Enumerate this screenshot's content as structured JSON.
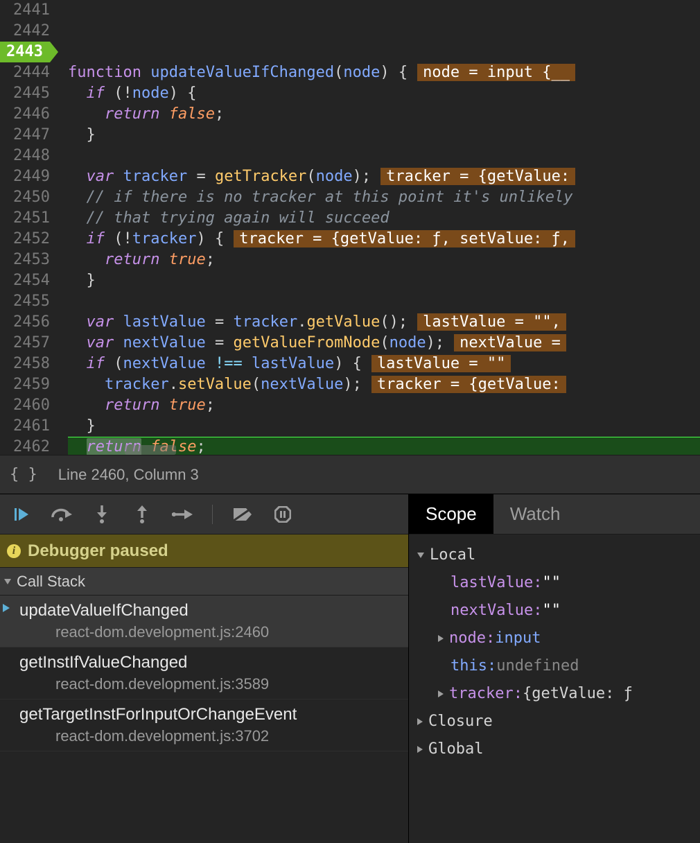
{
  "editor": {
    "first_line": 2441,
    "exec_line": 2443,
    "active_line": 2460,
    "lines": [
      {
        "n": 2441,
        "t": ""
      },
      {
        "n": 2442,
        "t": "function updateValueIfChanged(node) {",
        "eval": "node = input {__",
        "tokens": [
          [
            "kw-fn",
            "function"
          ],
          [
            "plain",
            " "
          ],
          [
            "fn-name",
            "updateValueIfChanged"
          ],
          [
            "paren",
            "("
          ],
          [
            "var-name",
            "node"
          ],
          [
            "paren",
            ")"
          ],
          [
            "plain",
            " {"
          ]
        ]
      },
      {
        "n": 2443,
        "tokens": [
          [
            "plain",
            "  "
          ],
          [
            "kw",
            "if"
          ],
          [
            "plain",
            " (!"
          ],
          [
            "var-name",
            "node"
          ],
          [
            "paren",
            ")"
          ],
          [
            "plain",
            " {"
          ]
        ]
      },
      {
        "n": 2444,
        "tokens": [
          [
            "plain",
            "    "
          ],
          [
            "kw",
            "return"
          ],
          [
            "plain",
            " "
          ],
          [
            "bool",
            "false"
          ],
          [
            "plain",
            ";"
          ]
        ]
      },
      {
        "n": 2445,
        "tokens": [
          [
            "plain",
            "  }"
          ]
        ]
      },
      {
        "n": 2446,
        "tokens": []
      },
      {
        "n": 2447,
        "eval": "tracker = {getValue:",
        "tokens": [
          [
            "plain",
            "  "
          ],
          [
            "kw",
            "var"
          ],
          [
            "plain",
            " "
          ],
          [
            "var-name",
            "tracker"
          ],
          [
            "plain",
            " = "
          ],
          [
            "call",
            "getTracker"
          ],
          [
            "paren",
            "("
          ],
          [
            "var-name",
            "node"
          ],
          [
            "paren",
            ")"
          ],
          [
            "plain",
            ";"
          ]
        ]
      },
      {
        "n": 2448,
        "tokens": [
          [
            "plain",
            "  "
          ],
          [
            "comment",
            "// if there is no tracker at this point it's unlikely"
          ]
        ]
      },
      {
        "n": 2449,
        "tokens": [
          [
            "plain",
            "  "
          ],
          [
            "comment",
            "// that trying again will succeed"
          ]
        ]
      },
      {
        "n": 2450,
        "eval": "tracker = {getValue: ƒ, setValue: ƒ,",
        "tokens": [
          [
            "plain",
            "  "
          ],
          [
            "kw",
            "if"
          ],
          [
            "plain",
            " (!"
          ],
          [
            "var-name",
            "tracker"
          ],
          [
            "paren",
            ")"
          ],
          [
            "plain",
            " {"
          ]
        ]
      },
      {
        "n": 2451,
        "tokens": [
          [
            "plain",
            "    "
          ],
          [
            "kw",
            "return"
          ],
          [
            "plain",
            " "
          ],
          [
            "bool",
            "true"
          ],
          [
            "plain",
            ";"
          ]
        ]
      },
      {
        "n": 2452,
        "tokens": [
          [
            "plain",
            "  }"
          ]
        ]
      },
      {
        "n": 2453,
        "tokens": []
      },
      {
        "n": 2454,
        "eval": "lastValue = \"\",",
        "tokens": [
          [
            "plain",
            "  "
          ],
          [
            "kw",
            "var"
          ],
          [
            "plain",
            " "
          ],
          [
            "var-name",
            "lastValue"
          ],
          [
            "plain",
            " = "
          ],
          [
            "var-name",
            "tracker"
          ],
          [
            "plain",
            "."
          ],
          [
            "call",
            "getValue"
          ],
          [
            "paren",
            "()"
          ],
          [
            "plain",
            ";"
          ]
        ]
      },
      {
        "n": 2455,
        "eval": "nextValue =",
        "tokens": [
          [
            "plain",
            "  "
          ],
          [
            "kw",
            "var"
          ],
          [
            "plain",
            " "
          ],
          [
            "var-name",
            "nextValue"
          ],
          [
            "plain",
            " = "
          ],
          [
            "call",
            "getValueFromNode"
          ],
          [
            "paren",
            "("
          ],
          [
            "var-name",
            "node"
          ],
          [
            "paren",
            ")"
          ],
          [
            "plain",
            ";"
          ]
        ]
      },
      {
        "n": 2456,
        "eval": "lastValue = \"\"",
        "tokens": [
          [
            "plain",
            "  "
          ],
          [
            "kw",
            "if"
          ],
          [
            "plain",
            " ("
          ],
          [
            "var-name",
            "nextValue"
          ],
          [
            "plain",
            " "
          ],
          [
            "op",
            "!=="
          ],
          [
            "plain",
            " "
          ],
          [
            "var-name",
            "lastValue"
          ],
          [
            "paren",
            ")"
          ],
          [
            "plain",
            " {"
          ]
        ]
      },
      {
        "n": 2457,
        "eval": "tracker = {getValue:",
        "tokens": [
          [
            "plain",
            "    "
          ],
          [
            "var-name",
            "tracker"
          ],
          [
            "plain",
            "."
          ],
          [
            "call",
            "setValue"
          ],
          [
            "paren",
            "("
          ],
          [
            "var-name",
            "nextValue"
          ],
          [
            "paren",
            ")"
          ],
          [
            "plain",
            ";"
          ]
        ]
      },
      {
        "n": 2458,
        "tokens": [
          [
            "plain",
            "    "
          ],
          [
            "kw",
            "return"
          ],
          [
            "plain",
            " "
          ],
          [
            "bool",
            "true"
          ],
          [
            "plain",
            ";"
          ]
        ]
      },
      {
        "n": 2459,
        "tokens": [
          [
            "plain",
            "  }"
          ]
        ]
      },
      {
        "n": 2460,
        "active": true,
        "tokens": [
          [
            "plain",
            "  "
          ],
          [
            "kw cursor",
            "return"
          ],
          [
            "plain",
            " "
          ],
          [
            "bool",
            "false"
          ],
          [
            "plain",
            ";"
          ]
        ]
      },
      {
        "n": 2461,
        "tokens": [
          [
            "plain",
            "}"
          ]
        ]
      },
      {
        "n": 2462,
        "tokens": []
      }
    ],
    "status_line_col": "Line 2460, Column 3",
    "braces_glyph": "{ }"
  },
  "debugger": {
    "toolbar_icons": [
      "resume",
      "step-over",
      "step-into",
      "step-out",
      "step",
      "deactivate-breakpoints",
      "pause-on-exceptions"
    ],
    "status_message": "Debugger paused",
    "call_stack_header": "Call Stack",
    "call_stack": [
      {
        "fn": "updateValueIfChanged",
        "loc": "react-dom.development.js:2460",
        "selected": true
      },
      {
        "fn": "getInstIfValueChanged",
        "loc": "react-dom.development.js:3589"
      },
      {
        "fn": "getTargetInstForInputOrChangeEvent",
        "loc": "react-dom.development.js:3702"
      }
    ]
  },
  "scope_panel": {
    "tabs": [
      "Scope",
      "Watch"
    ],
    "active_tab": "Scope",
    "sections": {
      "Local": {
        "expanded": true,
        "entries": [
          {
            "key": "lastValue",
            "val": "\"\"",
            "type": "str"
          },
          {
            "key": "nextValue",
            "val": "\"\"",
            "type": "str"
          },
          {
            "key": "node",
            "val": "input",
            "type": "obj",
            "expandable": true
          },
          {
            "key": "this",
            "val": "undefined",
            "type": "undef",
            "this": true
          },
          {
            "key": "tracker",
            "val": "{getValue: ƒ",
            "type": "obj",
            "expandable": true
          }
        ]
      },
      "Closure": {
        "expanded": false
      },
      "Global": {
        "expanded": false
      }
    }
  }
}
